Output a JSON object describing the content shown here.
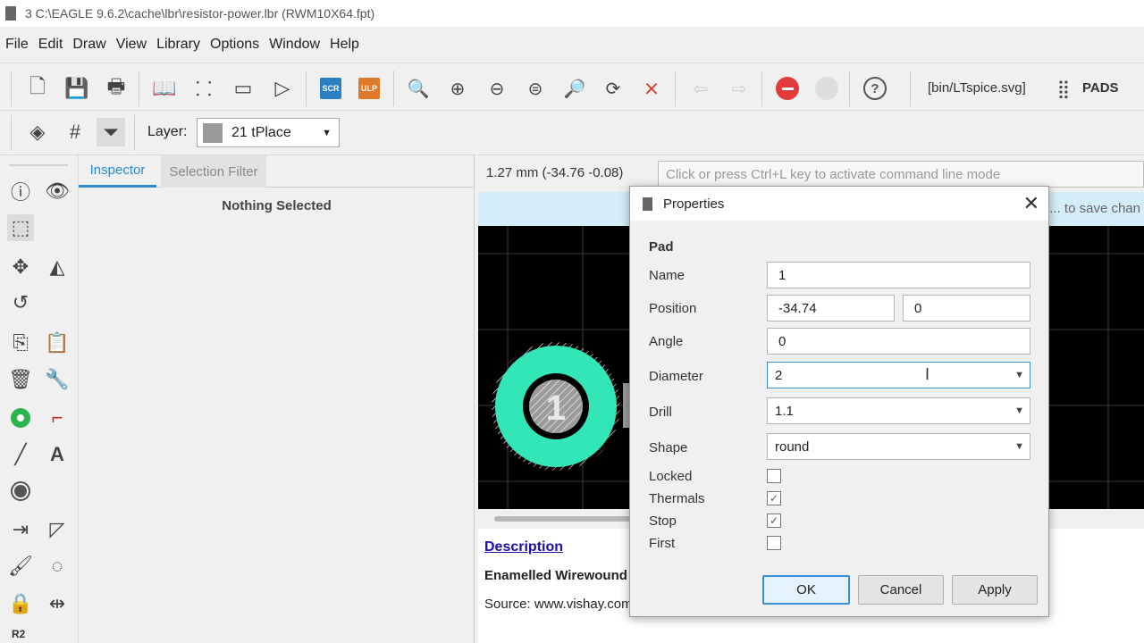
{
  "window": {
    "title": "3 C:\\EAGLE 9.6.2\\cache\\lbr\\resistor-power.lbr (RWM10X64.fpt)"
  },
  "menu": [
    "File",
    "Edit",
    "Draw",
    "View",
    "Library",
    "Options",
    "Window",
    "Help"
  ],
  "toolbar": {
    "scr_label": "SCR",
    "ulp_label": "ULP",
    "script_path": "[bin/LTspice.svg]",
    "pads_label": "PADS",
    "colors": {
      "scr": "#2a7fc1",
      "ulp": "#e07a2a",
      "stop": "#e03a3a"
    }
  },
  "layerbar": {
    "label": "Layer:",
    "selected": "21 tPlace",
    "swatch_color": "#9a9a9a"
  },
  "inspector": {
    "tabs": [
      "Inspector",
      "Selection Filter"
    ],
    "empty_text": "Nothing Selected"
  },
  "lefttools": {
    "r2_label": "R2"
  },
  "statusbar": {
    "coords": "1.27 mm (-34.76 -0.08)",
    "cmd_placeholder": "Click or press Ctrl+L key to activate command line mode",
    "info_text": "... to save chan"
  },
  "canvas": {
    "pad_number": "1",
    "colors": {
      "background": "#000000",
      "pad": "#33e6b8",
      "hole": "#9b9b9b",
      "grid": "#3a3a3a"
    }
  },
  "description": {
    "link": "Description",
    "heading": "Enamelled Wirewound",
    "source": "Source: www.vishay.com"
  },
  "dialog": {
    "title": "Properties",
    "section": "Pad",
    "name_label": "Name",
    "name_value": "1",
    "position_label": "Position",
    "position_x": "-34.74",
    "position_y": "0",
    "angle_label": "Angle",
    "angle_value": "0",
    "diameter_label": "Diameter",
    "diameter_value": "2",
    "drill_label": "Drill",
    "drill_value": "1.1",
    "shape_label": "Shape",
    "shape_value": "round",
    "locked_label": "Locked",
    "locked": false,
    "thermals_label": "Thermals",
    "thermals": true,
    "stop_label": "Stop",
    "stop": true,
    "first_label": "First",
    "first": false,
    "ok_label": "OK",
    "cancel_label": "Cancel",
    "apply_label": "Apply"
  }
}
